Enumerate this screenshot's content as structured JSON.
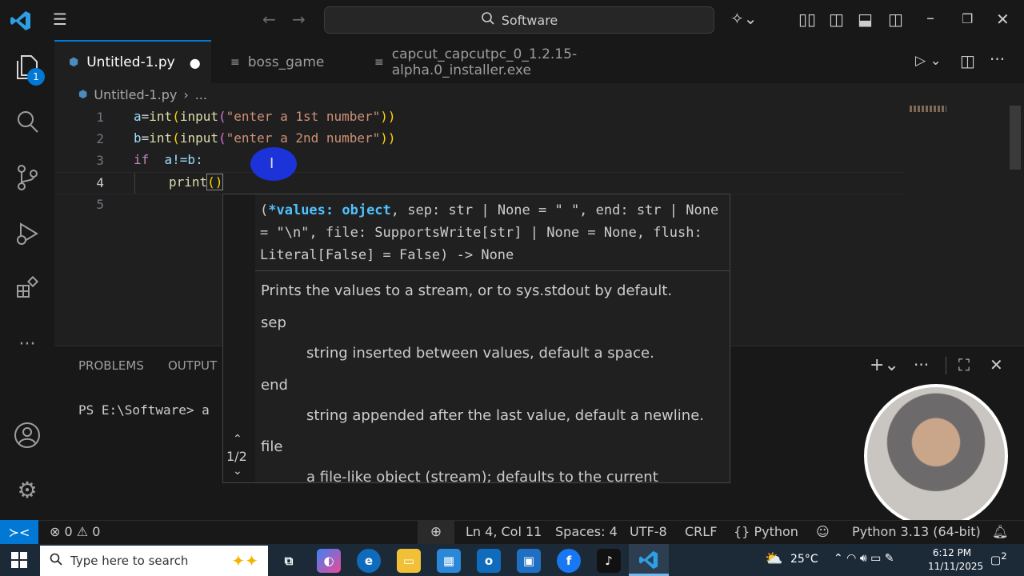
{
  "titlebar": {
    "search_label": "Software"
  },
  "activity": {
    "explorer_badge": "1",
    "items": [
      "explorer-icon",
      "search-icon",
      "source-control-icon",
      "run-debug-icon",
      "extensions-icon",
      "more-icon",
      "account-icon",
      "settings-gear-icon"
    ]
  },
  "tabs": [
    {
      "label": "Untitled-1.py",
      "dirty_dot": "●"
    },
    {
      "label": "boss_game"
    },
    {
      "label": "capcut_capcutpc_0_1.2.15-alpha.0_installer.exe"
    }
  ],
  "breadcrumb": {
    "file": "Untitled-1.py",
    "sep": "›",
    "rest": "..."
  },
  "editor": {
    "line_numbers": [
      "1",
      "2",
      "3",
      "4",
      "5"
    ],
    "line1": {
      "a": "a",
      "eq": "=",
      "int": "int",
      "p1": "(",
      "input": "input",
      "p2": "(",
      "str": "\"enter a 1st number\"",
      "p3": "))"
    },
    "line2": {
      "a": "b",
      "eq": "=",
      "int": "int",
      "p1": "(",
      "input": "input",
      "p2": "(",
      "str": "\"enter a 2nd number\"",
      "p3": "))"
    },
    "line3": {
      "kw": "if",
      "rest": "a!=b:"
    },
    "line4": {
      "fn": "print",
      "paren": "()"
    }
  },
  "hover": {
    "sig_bold": "*values: object",
    "sig_open": "(",
    "sig_rest": ", sep: str | None = \" \", end: str | None = \"\\n\", file: SupportsWrite[str] | None = None, flush: Literal[False] = False) -> None",
    "doc": "Prints the values to a stream, or to sys.stdout by default.",
    "params": [
      {
        "name": "sep",
        "desc": "string inserted between values, default a space."
      },
      {
        "name": "end",
        "desc": "string appended after the last value, default a newline."
      },
      {
        "name": "file",
        "desc": "a file-like object (stream); defaults to the current"
      }
    ],
    "page": "1/2"
  },
  "panel": {
    "tabs": [
      "PROBLEMS",
      "OUTPUT"
    ],
    "terminal_prompt": "PS E:\\Software> a"
  },
  "status": {
    "errors": "0",
    "warnings": "0",
    "position": "Ln 4, Col 11",
    "spaces": "Spaces: 4",
    "encoding": "UTF-8",
    "eol": "CRLF",
    "lang_braces": "{}",
    "language": "Python",
    "interpreter": "Python 3.13 (64-bit)"
  },
  "taskbar": {
    "search_placeholder": "Type here to search",
    "temperature": "25°C",
    "time": "6:12 PM",
    "date": "11/11/2025",
    "notifications": "2"
  },
  "colors": {
    "accent": "#0078d4",
    "string": "#ce9178",
    "keyword": "#c586c0",
    "function": "#dcdcaa"
  }
}
